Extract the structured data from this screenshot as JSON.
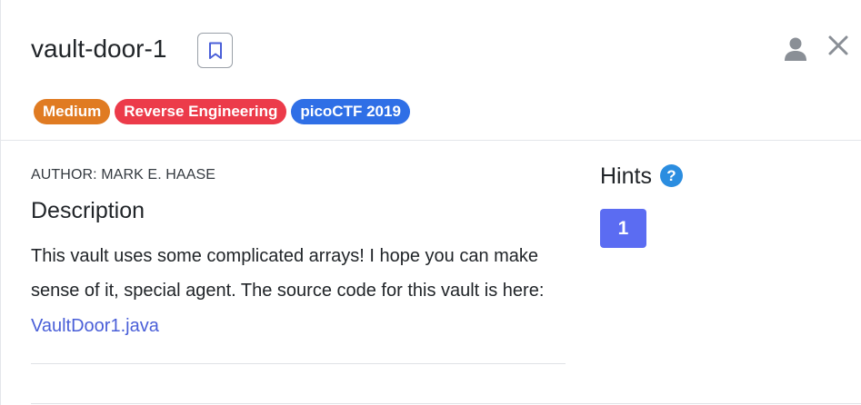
{
  "challenge": {
    "title": "vault-door-1",
    "author": "AUTHOR: MARK E. HAASE",
    "description_heading": "Description",
    "description_text": "This vault uses some complicated arrays! I hope you can make sense of it, special agent. The source code for this vault is here:",
    "source_link": "VaultDoor1.java"
  },
  "badges": [
    {
      "label": "Medium",
      "color": "#e07b22"
    },
    {
      "label": "Reverse Engineering",
      "color": "#ec3b4a"
    },
    {
      "label": "picoCTF 2019",
      "color": "#2f6fe6"
    }
  ],
  "hints": {
    "heading": "Hints",
    "help_glyph": "?",
    "items": [
      {
        "label": "1"
      }
    ]
  },
  "icons": {
    "bookmark": "bookmark-icon",
    "user": "user-icon",
    "close": "close-icon"
  },
  "colors": {
    "link": "#4a5fd8",
    "hint_button": "#5b6cf2",
    "help_icon": "#2b8de0"
  }
}
